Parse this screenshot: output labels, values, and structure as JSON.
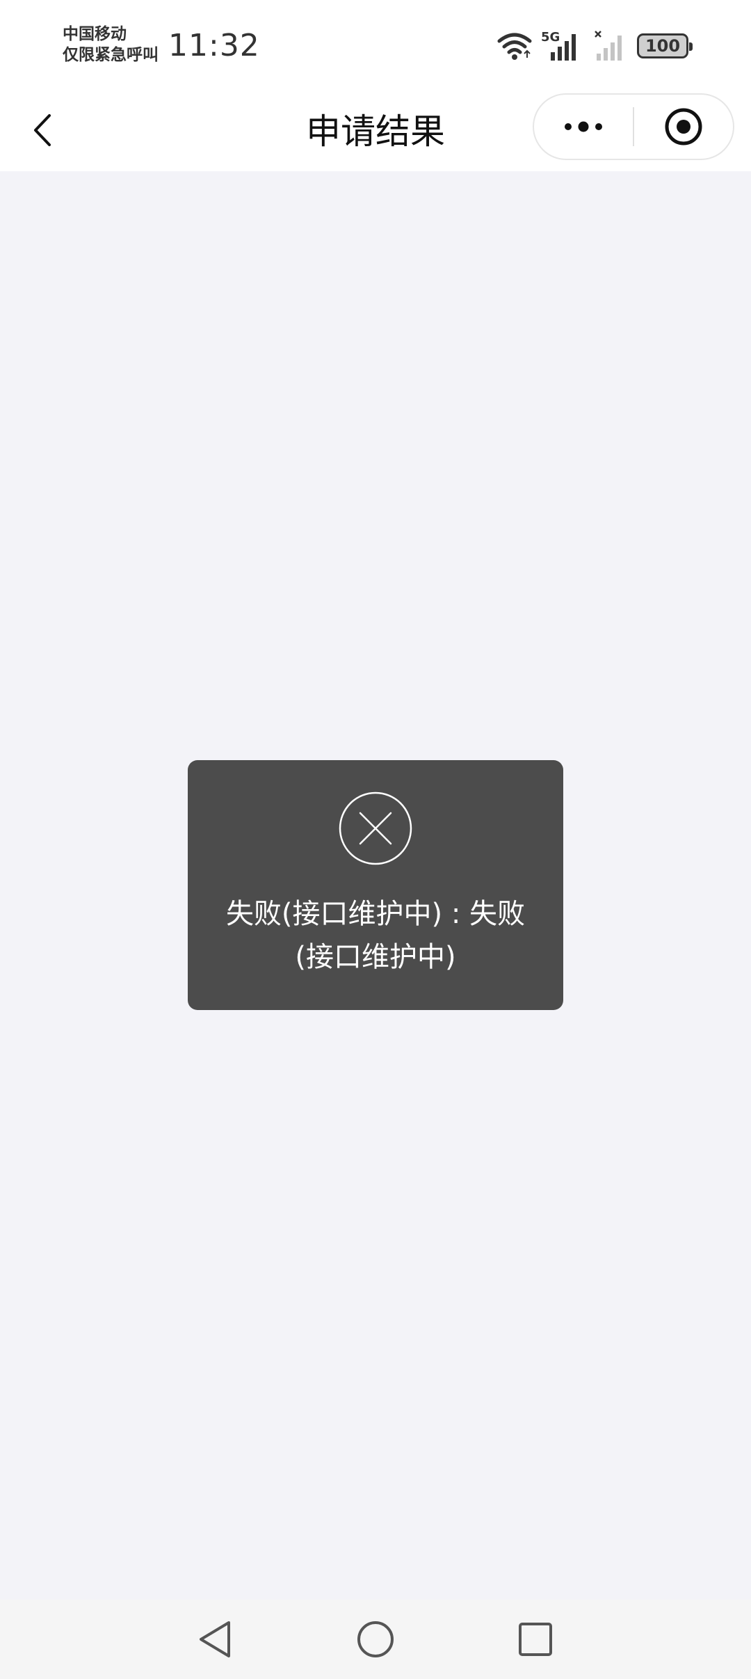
{
  "status_bar": {
    "carrier_line1": "中国移动",
    "carrier_line2": "仅限紧急呼叫",
    "time": "11:32",
    "network_label": "5G",
    "battery_level": "100"
  },
  "nav": {
    "title": "申请结果"
  },
  "toast": {
    "message": "失败(接口维护中) : 失败(接口维护中)",
    "icon": "close-circle-icon"
  },
  "colors": {
    "page_bg": "#f3f3f8",
    "toast_bg": "#4c4c4c",
    "text_dark": "#111111"
  }
}
